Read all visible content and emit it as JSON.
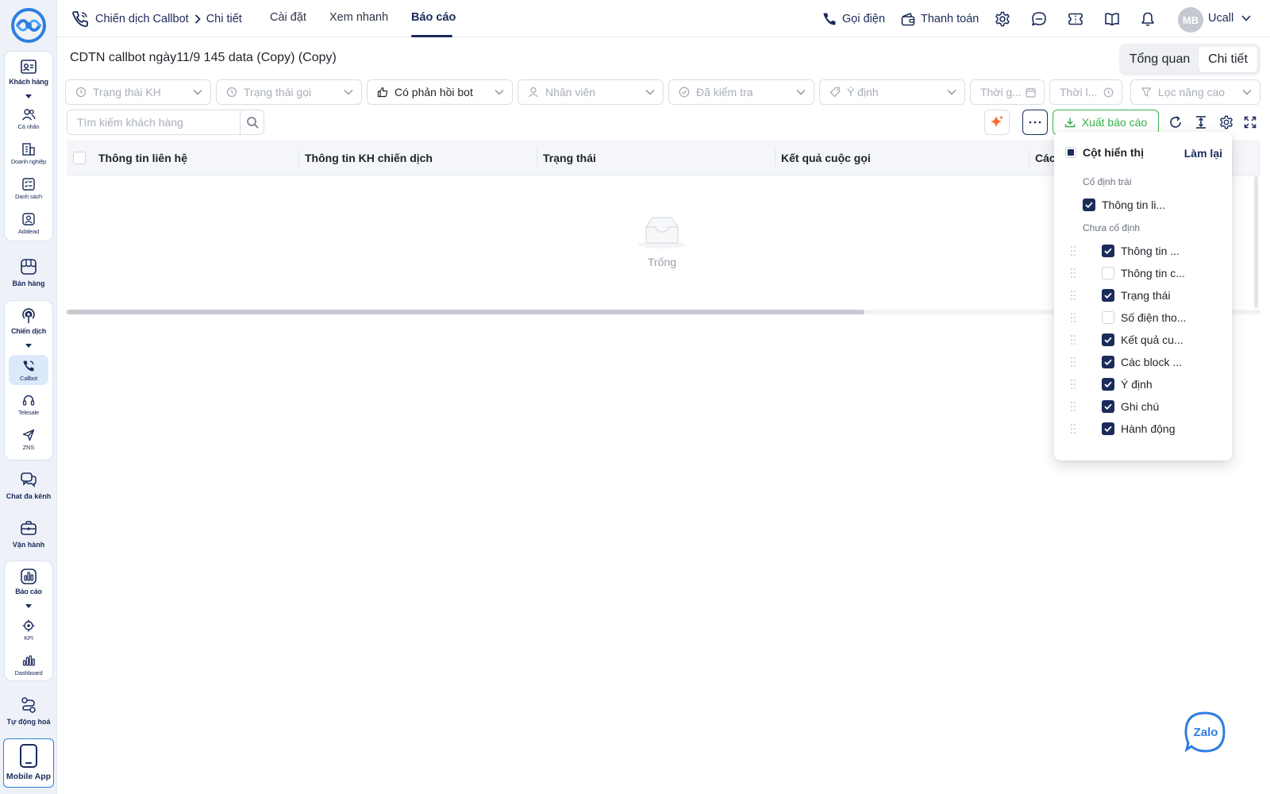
{
  "topbar": {
    "breadcrumb": [
      "Chiến dịch Callbot",
      "Chi tiết"
    ],
    "tabs": [
      {
        "label": "Cài đặt",
        "active": false
      },
      {
        "label": "Xem nhanh",
        "active": false
      },
      {
        "label": "Báo cáo",
        "active": true
      }
    ],
    "call_label": "Gọi điện",
    "payment_label": "Thanh toán",
    "icons": [
      "settings-icon",
      "message-icon",
      "ticket-icon",
      "book-icon",
      "bell-icon"
    ],
    "user_initials": "MB",
    "user_name": "Ucall"
  },
  "sidebar": {
    "groups": [
      {
        "label": "Khách hàng",
        "icon": "contact-card-icon",
        "children": [
          {
            "label": "Cá nhân",
            "icon": "users-icon"
          },
          {
            "label": "Doanh nghiệp",
            "icon": "building-icon"
          },
          {
            "label": "Danh sách",
            "icon": "list-icon"
          },
          {
            "label": "Adalead",
            "icon": "user-badge-icon"
          }
        ]
      },
      {
        "label": "Bán hàng",
        "icon": "store-icon"
      },
      {
        "label": "Chiến dịch",
        "icon": "broadcast-icon",
        "children": [
          {
            "label": "Callbot",
            "icon": "phone-icon",
            "active": true
          },
          {
            "label": "Telesale",
            "icon": "headset-icon"
          },
          {
            "label": "ZNS",
            "icon": "send-icon"
          }
        ]
      },
      {
        "label": "Chat đa kênh",
        "icon": "chat-icon"
      },
      {
        "label": "Vận hành",
        "icon": "briefcase-icon"
      },
      {
        "label": "Báo cáo",
        "icon": "report-icon",
        "children": [
          {
            "label": "KPI",
            "icon": "target-icon"
          },
          {
            "label": "Dashboard",
            "icon": "bar-chart-icon"
          }
        ]
      },
      {
        "label": "Tự động hoá",
        "icon": "automation-icon"
      }
    ],
    "mobile_app_label": "Mobile App"
  },
  "page": {
    "title": "CDTN callbot ngày11/9 145 data (Copy) (Copy)",
    "view_toggle": [
      {
        "label": "Tổng quan",
        "active": false
      },
      {
        "label": "Chi tiết",
        "active": true
      }
    ]
  },
  "filters": [
    {
      "label": "Trạng thái KH",
      "icon": "clock-icon",
      "suffix": "chevron",
      "filled": false
    },
    {
      "label": "Trạng thái gọi",
      "icon": "clock-icon",
      "suffix": "chevron",
      "filled": false
    },
    {
      "label": "Có phản hồi bot",
      "icon": "thumb-up-icon",
      "suffix": "chevron",
      "filled": true
    },
    {
      "label": "Nhân viên",
      "icon": "user-icon",
      "suffix": "chevron",
      "filled": false
    },
    {
      "label": "Đã kiểm tra",
      "icon": "check-circle-icon",
      "suffix": "chevron",
      "filled": false
    },
    {
      "label": "Ý định",
      "icon": "tag-icon",
      "suffix": "chevron",
      "filled": false
    },
    {
      "label": "Thời g...",
      "icon": "",
      "suffix": "calendar",
      "filled": false
    },
    {
      "label": "Thời l...",
      "icon": "",
      "suffix": "clock",
      "filled": false
    },
    {
      "label": "Lọc nâng cao",
      "icon": "funnel-icon",
      "suffix": "chevron",
      "filled": false
    }
  ],
  "toolbar": {
    "search_placeholder": "Tìm kiếm khách hàng",
    "export_label": "Xuất báo cáo"
  },
  "table": {
    "columns": [
      "Thông tin liên hệ",
      "Thông tin KH chiến dịch",
      "Trạng thái",
      "Kết quả cuộc gọi",
      "Các"
    ],
    "empty_text": "Trống"
  },
  "column_panel": {
    "title": "Cột hiển thị",
    "reset_label": "Làm lại",
    "fixed_left_label": "Cố định trái",
    "unfixed_label": "Chưa cố định",
    "fixed": [
      {
        "label": "Thông tin li...",
        "checked": true
      }
    ],
    "unfixed": [
      {
        "label": "Thông tin ...",
        "checked": true
      },
      {
        "label": "Thông tin c...",
        "checked": false
      },
      {
        "label": "Trạng thái",
        "checked": true
      },
      {
        "label": "Số điện tho...",
        "checked": false
      },
      {
        "label": "Kết quả cu...",
        "checked": true
      },
      {
        "label": "Các block ...",
        "checked": true
      },
      {
        "label": "Ý định",
        "checked": true
      },
      {
        "label": "Ghi chú",
        "checked": true
      },
      {
        "label": "Hành động",
        "checked": true
      }
    ]
  },
  "zalo_label": "Zalo",
  "colors": {
    "navy": "#1b2b5a",
    "accent_blue": "#2f7ee0",
    "export_green": "#35b14a",
    "ai_orange": "#ff6a2b"
  }
}
